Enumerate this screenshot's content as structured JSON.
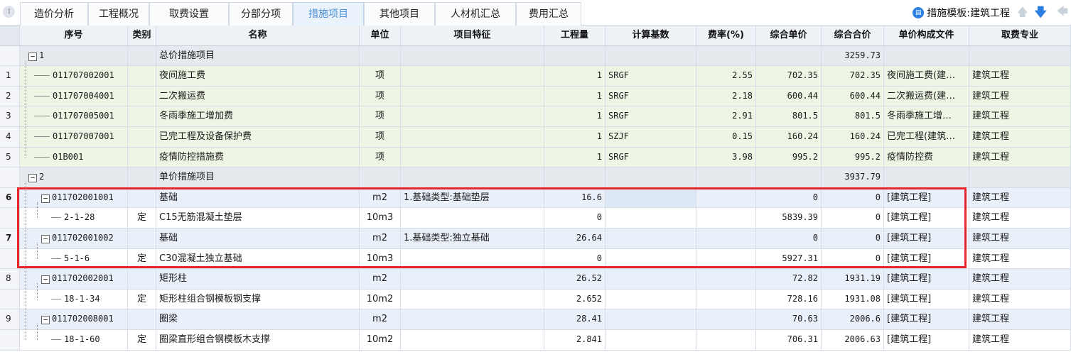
{
  "tabs": [
    {
      "label": "造价分析"
    },
    {
      "label": "工程概况"
    },
    {
      "label": "取费设置"
    },
    {
      "label": "分部分项"
    },
    {
      "label": "措施项目"
    },
    {
      "label": "其他项目"
    },
    {
      "label": "人材机汇总"
    },
    {
      "label": "费用汇总"
    }
  ],
  "active_tab": "措施项目",
  "template": {
    "label": "措施模板:建筑工程"
  },
  "columns": [
    "序号",
    "类别",
    "名称",
    "单位",
    "项目特征",
    "工程量",
    "计算基数",
    "费率(%)",
    "综合单价",
    "综合合价",
    "单价构成文件",
    "取费专业"
  ],
  "rows": [
    {
      "no": "",
      "code": "1",
      "type": "",
      "name": "总价措施项目",
      "unit": "",
      "feature": "",
      "qty": "",
      "base": "",
      "rate": "",
      "price": "",
      "total": "3259.73",
      "file": "",
      "major": ""
    },
    {
      "no": "1",
      "code": "011707002001",
      "type": "",
      "name": "夜间施工费",
      "unit": "项",
      "feature": "",
      "qty": "1",
      "base": "SRGF",
      "rate": "2.55",
      "price": "702.35",
      "total": "702.35",
      "file": "夜间施工费(建…",
      "major": "建筑工程"
    },
    {
      "no": "2",
      "code": "011707004001",
      "type": "",
      "name": "二次搬运费",
      "unit": "项",
      "feature": "",
      "qty": "1",
      "base": "SRGF",
      "rate": "2.18",
      "price": "600.44",
      "total": "600.44",
      "file": "二次搬运费(建…",
      "major": "建筑工程"
    },
    {
      "no": "3",
      "code": "011707005001",
      "type": "",
      "name": "冬雨季施工增加费",
      "unit": "项",
      "feature": "",
      "qty": "1",
      "base": "SRGF",
      "rate": "2.91",
      "price": "801.5",
      "total": "801.5",
      "file": "冬雨季施工增…",
      "major": "建筑工程"
    },
    {
      "no": "4",
      "code": "011707007001",
      "type": "",
      "name": "已完工程及设备保护费",
      "unit": "项",
      "feature": "",
      "qty": "1",
      "base": "SZJF",
      "rate": "0.15",
      "price": "160.24",
      "total": "160.24",
      "file": "已完工程(建筑…",
      "major": "建筑工程"
    },
    {
      "no": "5",
      "code": "01B001",
      "type": "",
      "name": "疫情防控措施费",
      "unit": "项",
      "feature": "",
      "qty": "1",
      "base": "SRGF",
      "rate": "3.98",
      "price": "995.2",
      "total": "995.2",
      "file": "疫情防控费",
      "major": "建筑工程"
    },
    {
      "no": "",
      "code": "2",
      "type": "",
      "name": "单价措施项目",
      "unit": "",
      "feature": "",
      "qty": "",
      "base": "",
      "rate": "",
      "price": "",
      "total": "3937.79",
      "file": "",
      "major": ""
    },
    {
      "no": "6",
      "code": "011702001001",
      "type": "",
      "name": "基础",
      "unit": "m2",
      "feature": "1.基础类型:基础垫层",
      "qty": "16.6",
      "base": "",
      "rate": "",
      "price": "0",
      "total": "0",
      "file": "[建筑工程]",
      "major": "建筑工程"
    },
    {
      "no": "",
      "code": "2-1-28",
      "type": "定",
      "name": "C15无筋混凝土垫层",
      "unit": "10m3",
      "feature": "",
      "qty": "0",
      "base": "",
      "rate": "",
      "price": "5839.39",
      "total": "0",
      "file": "[建筑工程]",
      "major": "建筑工程"
    },
    {
      "no": "7",
      "code": "011702001002",
      "type": "",
      "name": "基础",
      "unit": "m2",
      "feature": "1.基础类型:独立基础",
      "qty": "26.64",
      "base": "",
      "rate": "",
      "price": "0",
      "total": "0",
      "file": "[建筑工程]",
      "major": "建筑工程"
    },
    {
      "no": "",
      "code": "5-1-6",
      "type": "定",
      "name": "C30混凝土独立基础",
      "unit": "10m3",
      "feature": "",
      "qty": "0",
      "base": "",
      "rate": "",
      "price": "5927.31",
      "total": "0",
      "file": "[建筑工程]",
      "major": "建筑工程"
    },
    {
      "no": "8",
      "code": "011702002001",
      "type": "",
      "name": "矩形柱",
      "unit": "m2",
      "feature": "",
      "qty": "26.52",
      "base": "",
      "rate": "",
      "price": "72.82",
      "total": "1931.19",
      "file": "[建筑工程]",
      "major": "建筑工程"
    },
    {
      "no": "",
      "code": "18-1-34",
      "type": "定",
      "name": "矩形柱组合钢模板钢支撑",
      "unit": "10m2",
      "feature": "",
      "qty": "2.652",
      "base": "",
      "rate": "",
      "price": "728.16",
      "total": "1931.08",
      "file": "[建筑工程]",
      "major": "建筑工程"
    },
    {
      "no": "9",
      "code": "011702008001",
      "type": "",
      "name": "圈梁",
      "unit": "m2",
      "feature": "",
      "qty": "28.41",
      "base": "",
      "rate": "",
      "price": "70.63",
      "total": "2006.6",
      "file": "[建筑工程]",
      "major": "建筑工程"
    },
    {
      "no": "",
      "code": "18-1-60",
      "type": "定",
      "name": "圈梁直形组合钢模板木支撑",
      "unit": "10m2",
      "feature": "",
      "qty": "2.841",
      "base": "",
      "rate": "",
      "price": "706.31",
      "total": "2006.63",
      "file": "[建筑工程]",
      "major": "建筑工程"
    }
  ],
  "colors": {
    "accent": "#2d7fe0",
    "highlight_box": "#e8262b",
    "green_row": "#eef5e4",
    "blue_row": "#e9f0fa",
    "group_row": "#e6eaef"
  }
}
